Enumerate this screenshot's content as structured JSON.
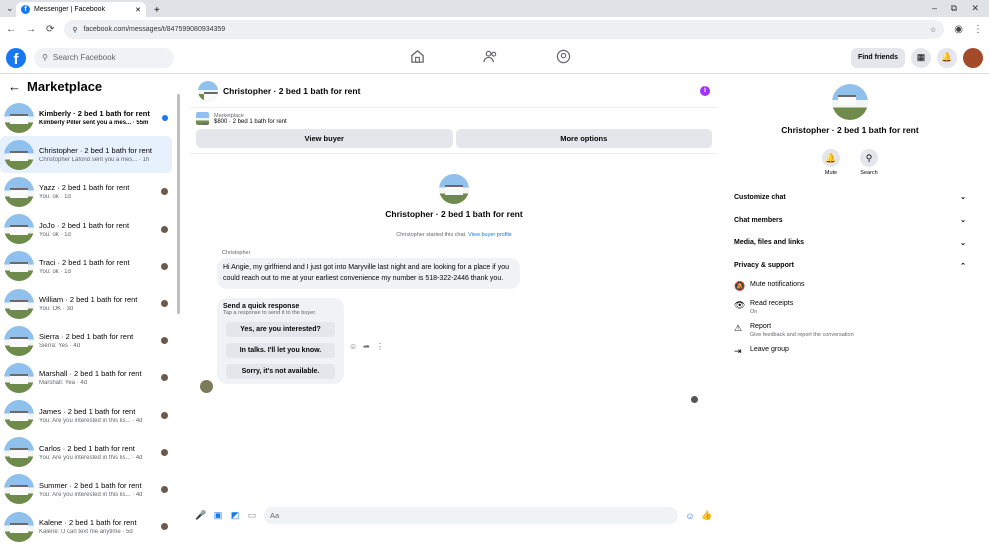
{
  "browser": {
    "tab_title": "Messenger | Facebook",
    "url": "facebook.com/messages/t/847599080934359"
  },
  "fb": {
    "search_placeholder": "Search Facebook",
    "find_friends": "Find friends"
  },
  "sidebar": {
    "title": "Marketplace",
    "conversations": [
      {
        "name": "Kimberly · 2 bed 1 bath for rent",
        "snippet": "Kimberly Piller sent you a mes... · 55m",
        "unread": true
      },
      {
        "name": "Christopher · 2 bed 1 bath for rent",
        "snippet": "Christopher Lafond sent you a mes... · 1h",
        "active": true
      },
      {
        "name": "Yazz · 2 bed 1 bath for rent",
        "snippet": "You: ok · 1d"
      },
      {
        "name": "JoJo · 2 bed 1 bath for rent",
        "snippet": "You: ok · 1d"
      },
      {
        "name": "Traci · 2 bed 1 bath for rent",
        "snippet": "You: ok · 1d"
      },
      {
        "name": "William · 2 bed 1 bath for rent",
        "snippet": "You: OK · 3d"
      },
      {
        "name": "Sierra · 2 bed 1 bath for rent",
        "snippet": "Sierra: Yes · 4d"
      },
      {
        "name": "Marshall · 2 bed 1 bath for rent",
        "snippet": "Marshall: Yea · 4d"
      },
      {
        "name": "James · 2 bed 1 bath for rent",
        "snippet": "You: Are you interested in this lis... · 4d"
      },
      {
        "name": "Carlos · 2 bed 1 bath for rent",
        "snippet": "You: Are you interested in this lis... · 4d"
      },
      {
        "name": "Summer · 2 bed 1 bath for rent",
        "snippet": "You: Are you interested in this lis... · 4d"
      },
      {
        "name": "Kalene · 2 bed 1 bath for rent",
        "snippet": "Kalene: U can text me anytime · 5d"
      }
    ]
  },
  "chat": {
    "title": "Christopher · 2 bed 1 bath for rent",
    "marketplace_label": "Marketplace",
    "listing": "$800 · 2 bed 1 bath for rent",
    "view_buyer": "View buyer",
    "more_options": "More options",
    "started_text": "Christopher started this chat.",
    "view_profile": "View buyer profile",
    "sender": "Christopher",
    "message": "Hi Angie, my girlfriend and I just got into Maryville last night and are looking for a place if you could reach out to me at your earliest convenience my number is 518-322-2446 thank you.",
    "quick": {
      "title": "Send a quick response",
      "subtitle": "Tap a response to send it to the buyer.",
      "options": [
        "Yes, are you interested?",
        "In talks. I'll let you know.",
        "Sorry, it's not available."
      ]
    },
    "composer_placeholder": "Aa"
  },
  "panel": {
    "name": "Christopher · 2 bed 1 bath for rent",
    "mute": "Mute",
    "search": "Search",
    "sections": [
      "Customize chat",
      "Chat members",
      "Media, files and links",
      "Privacy & support"
    ],
    "items": [
      {
        "title": "Mute notifications",
        "sub": ""
      },
      {
        "title": "Read receipts",
        "sub": "On"
      },
      {
        "title": "Report",
        "sub": "Give feedback and report the conversation"
      },
      {
        "title": "Leave group",
        "sub": ""
      }
    ]
  }
}
